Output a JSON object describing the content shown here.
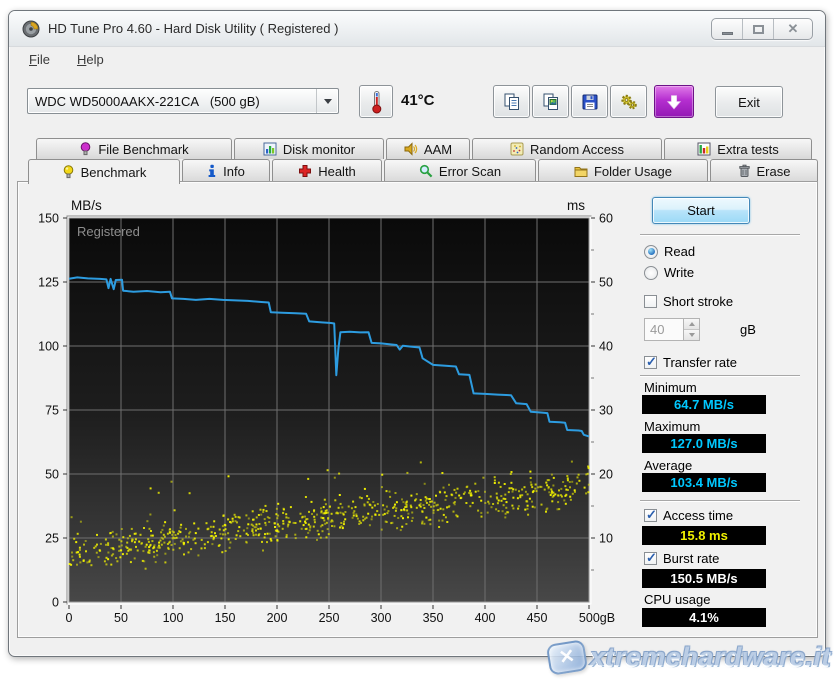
{
  "window": {
    "title": "HD Tune Pro 4.60 - Hard Disk Utility (  Registered )"
  },
  "menu": {
    "items": [
      {
        "label": "File"
      },
      {
        "label": "Help"
      }
    ]
  },
  "toolbar": {
    "drive_select_value": "WDC WD5000AAKX-221CA   (500 gB)",
    "temperature": "41°C",
    "exit_label": "Exit",
    "icon_buttons": [
      "copy-text",
      "copy-image",
      "save",
      "options",
      "download"
    ]
  },
  "tabs": {
    "row1": [
      {
        "label": "File Benchmark",
        "icon": "bulb-purple-icon",
        "active": false
      },
      {
        "label": "Disk monitor",
        "icon": "bar-chart-icon",
        "active": false
      },
      {
        "label": "AAM",
        "icon": "speaker-icon",
        "active": false
      },
      {
        "label": "Random Access",
        "icon": "scatter-icon",
        "active": false
      },
      {
        "label": "Extra tests",
        "icon": "extra-tests-icon",
        "active": false
      }
    ],
    "row2": [
      {
        "label": "Benchmark",
        "icon": "bulb-yellow-icon",
        "active": true
      },
      {
        "label": "Info",
        "icon": "info-icon",
        "active": false
      },
      {
        "label": "Health",
        "icon": "health-cross-icon",
        "active": false
      },
      {
        "label": "Error Scan",
        "icon": "magnifier-icon",
        "active": false
      },
      {
        "label": "Folder Usage",
        "icon": "folder-icon",
        "active": false
      },
      {
        "label": "Erase",
        "icon": "trash-icon",
        "active": false
      }
    ]
  },
  "sidebar": {
    "start_label": "Start",
    "read_label": "Read",
    "write_label": "Write",
    "read_selected": true,
    "write_selected": false,
    "short_stroke": {
      "label": "Short stroke",
      "checked": false,
      "value": "40",
      "unit": "gB",
      "enabled": false
    },
    "transfer_rate": {
      "label": "Transfer rate",
      "checked": true
    },
    "minimum": {
      "label": "Minimum",
      "value": "64.7 MB/s",
      "color": "#00c8ff"
    },
    "maximum": {
      "label": "Maximum",
      "value": "127.0 MB/s",
      "color": "#00c8ff"
    },
    "average": {
      "label": "Average",
      "value": "103.4 MB/s",
      "color": "#00c8ff"
    },
    "access_time": {
      "label": "Access time",
      "value": "15.8 ms",
      "color": "#f0f000",
      "checked": true
    },
    "burst_rate": {
      "label": "Burst rate",
      "value": "150.5 MB/s",
      "color": "#ffffff",
      "checked": true
    },
    "cpu_usage": {
      "label": "CPU usage",
      "value": "4.1%",
      "color": "#ffffff"
    }
  },
  "chart_data": {
    "type": "line+scatter",
    "registered_label": "Registered",
    "x_axis": {
      "min": 0,
      "max": 500,
      "ticks": [
        0,
        50,
        100,
        150,
        200,
        250,
        300,
        350,
        400,
        450,
        500
      ],
      "last_tick_suffix": "gB"
    },
    "y_left": {
      "label": "MB/s",
      "min": 0,
      "max": 150,
      "ticks": [
        150,
        125,
        100,
        75,
        50,
        25,
        0
      ]
    },
    "y_right": {
      "label": "ms",
      "min": 0,
      "max": 60,
      "ticks": [
        60,
        50,
        40,
        30,
        20,
        10
      ]
    },
    "grid_color": "#6f6f6f",
    "plot_bg_top": "#0a0a0a",
    "plot_bg_bottom": "#484848",
    "transfer_rate_line": {
      "name": "Read transfer rate (MB/s vs gB)",
      "color": "#2d9ce0",
      "points": [
        [
          0,
          126.3
        ],
        [
          8,
          126.8
        ],
        [
          18,
          126.4
        ],
        [
          30,
          126.2
        ],
        [
          36,
          126.0
        ],
        [
          38,
          122.6
        ],
        [
          40,
          126.2
        ],
        [
          43,
          122.2
        ],
        [
          45,
          125.8
        ],
        [
          51,
          125.9
        ],
        [
          52,
          121.6
        ],
        [
          62,
          121.2
        ],
        [
          75,
          121.5
        ],
        [
          88,
          121.0
        ],
        [
          97,
          121.2
        ],
        [
          99,
          118.6
        ],
        [
          110,
          118.4
        ],
        [
          122,
          118.0
        ],
        [
          135,
          118.4
        ],
        [
          148,
          118.0
        ],
        [
          160,
          117.8
        ],
        [
          172,
          117.6
        ],
        [
          185,
          117.2
        ],
        [
          192,
          117.0
        ],
        [
          194,
          113.2
        ],
        [
          205,
          113.0
        ],
        [
          218,
          112.8
        ],
        [
          228,
          112.6
        ],
        [
          231,
          109.6
        ],
        [
          243,
          109.2
        ],
        [
          252,
          109.0
        ],
        [
          255,
          108.8
        ],
        [
          257,
          88.6
        ],
        [
          259,
          99.0
        ],
        [
          261,
          105.4
        ],
        [
          270,
          105.6
        ],
        [
          280,
          105.3
        ],
        [
          288,
          105.4
        ],
        [
          291,
          101.2
        ],
        [
          300,
          101.0
        ],
        [
          308,
          100.7
        ],
        [
          315,
          100.4
        ],
        [
          318,
          98.6
        ],
        [
          321,
          100.1
        ],
        [
          330,
          99.7
        ],
        [
          337,
          99.4
        ],
        [
          340,
          95.2
        ],
        [
          350,
          92.6
        ],
        [
          362,
          92.3
        ],
        [
          372,
          92.0
        ],
        [
          375,
          89.0
        ],
        [
          385,
          88.7
        ],
        [
          389,
          81.5
        ],
        [
          400,
          81.3
        ],
        [
          412,
          81.0
        ],
        [
          425,
          80.8
        ],
        [
          430,
          77.6
        ],
        [
          440,
          77.3
        ],
        [
          444,
          74.3
        ],
        [
          455,
          74.0
        ],
        [
          460,
          73.8
        ],
        [
          462,
          70.4
        ],
        [
          472,
          70.2
        ],
        [
          477,
          70.0
        ],
        [
          479,
          67.2
        ],
        [
          490,
          67.0
        ],
        [
          493,
          66.8
        ],
        [
          495,
          65.3
        ],
        [
          500,
          64.7
        ]
      ]
    },
    "access_time_scatter": {
      "name": "Access time (ms vs gB)",
      "color": "#f2f200",
      "count": 780,
      "ms_center_start": 7.8,
      "ms_center_end": 18.5,
      "ms_spread": 4.5,
      "seed": 1337
    }
  },
  "watermark": {
    "text": "xtremehardware.it",
    "logo_glyph": "✕"
  }
}
